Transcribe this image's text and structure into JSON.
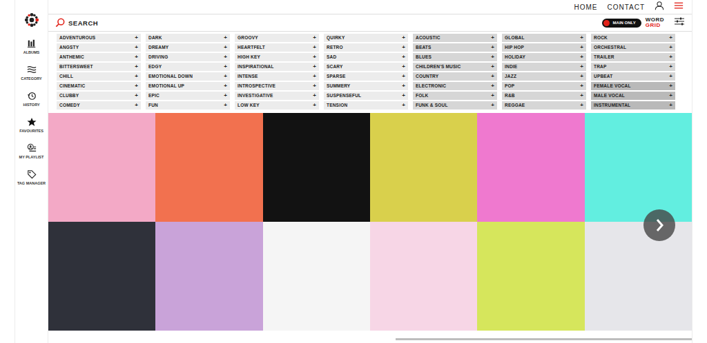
{
  "nav": {
    "links": [
      {
        "label": "HOME"
      },
      {
        "label": "CONTACT"
      }
    ]
  },
  "search": {
    "label": "SEARCH"
  },
  "toggle": {
    "label": "MAIN ONLY",
    "on": true
  },
  "brand": {
    "line1": "WORD",
    "line2": "GRID"
  },
  "sidebar": {
    "items": [
      {
        "label": "ALBUMS",
        "selected": false
      },
      {
        "label": "CATEGORY",
        "selected": false
      },
      {
        "label": "HISTORY",
        "selected": false
      },
      {
        "label": "FAVOURITES",
        "selected": false
      },
      {
        "label": "MY PLAYLIST",
        "selected": false
      },
      {
        "label": "TAG MANAGER",
        "selected": false
      }
    ]
  },
  "add_glyph": "+",
  "tag_columns": [
    {
      "tags": [
        {
          "label": "ADVENTUROUS",
          "kind": "mood",
          "selected": false
        },
        {
          "label": "ANGSTY",
          "kind": "mood",
          "selected": false
        },
        {
          "label": "ANTHEMIC",
          "kind": "mood",
          "selected": false
        },
        {
          "label": "BITTERSWEET",
          "kind": "mood",
          "selected": false
        },
        {
          "label": "CHILL",
          "kind": "mood",
          "selected": false
        },
        {
          "label": "CINEMATIC",
          "kind": "mood",
          "selected": false
        },
        {
          "label": "CLUBBY",
          "kind": "mood",
          "selected": false
        },
        {
          "label": "COMEDY",
          "kind": "mood",
          "selected": false
        }
      ]
    },
    {
      "tags": [
        {
          "label": "DARK",
          "kind": "mood",
          "selected": false
        },
        {
          "label": "DREAMY",
          "kind": "mood",
          "selected": false
        },
        {
          "label": "DRIVING",
          "kind": "mood",
          "selected": false
        },
        {
          "label": "EDGY",
          "kind": "mood",
          "selected": false
        },
        {
          "label": "EMOTIONAL DOWN",
          "kind": "mood",
          "selected": false
        },
        {
          "label": "EMOTIONAL UP",
          "kind": "mood",
          "selected": false
        },
        {
          "label": "EPIC",
          "kind": "mood",
          "selected": false
        },
        {
          "label": "FUN",
          "kind": "mood",
          "selected": false
        }
      ]
    },
    {
      "tags": [
        {
          "label": "GROOVY",
          "kind": "mood",
          "selected": false
        },
        {
          "label": "HEARTFELT",
          "kind": "mood",
          "selected": false
        },
        {
          "label": "HIGH KEY",
          "kind": "mood",
          "selected": false
        },
        {
          "label": "INSPIRATIONAL",
          "kind": "mood",
          "selected": false
        },
        {
          "label": "INTENSE",
          "kind": "mood",
          "selected": false
        },
        {
          "label": "INTROSPECTIVE",
          "kind": "mood",
          "selected": false
        },
        {
          "label": "INVESTIGATIVE",
          "kind": "mood",
          "selected": false
        },
        {
          "label": "LOW KEY",
          "kind": "mood",
          "selected": false
        }
      ]
    },
    {
      "tags": [
        {
          "label": "QUIRKY",
          "kind": "mood",
          "selected": false
        },
        {
          "label": "RETRO",
          "kind": "mood",
          "selected": false
        },
        {
          "label": "SAD",
          "kind": "mood",
          "selected": false
        },
        {
          "label": "SCARY",
          "kind": "mood",
          "selected": false
        },
        {
          "label": "SPARSE",
          "kind": "mood",
          "selected": false
        },
        {
          "label": "SUMMERY",
          "kind": "mood",
          "selected": false
        },
        {
          "label": "SUSPENSEFUL",
          "kind": "mood",
          "selected": false
        },
        {
          "label": "TENSION",
          "kind": "mood",
          "selected": false
        }
      ]
    },
    {
      "tags": [
        {
          "label": "ACOUSTIC",
          "kind": "genre",
          "selected": false
        },
        {
          "label": "BEATS",
          "kind": "genre",
          "selected": false
        },
        {
          "label": "BLUES",
          "kind": "genre",
          "selected": false
        },
        {
          "label": "CHILDREN'S MUSIC",
          "kind": "genre",
          "selected": false
        },
        {
          "label": "COUNTRY",
          "kind": "genre",
          "selected": false
        },
        {
          "label": "ELECTRONIC",
          "kind": "genre",
          "selected": false
        },
        {
          "label": "FOLK",
          "kind": "genre",
          "selected": false
        },
        {
          "label": "FUNK & SOUL",
          "kind": "genre",
          "selected": false
        }
      ]
    },
    {
      "tags": [
        {
          "label": "GLOBAL",
          "kind": "genre",
          "selected": false
        },
        {
          "label": "HIP HOP",
          "kind": "genre",
          "selected": false
        },
        {
          "label": "HOLIDAY",
          "kind": "genre",
          "selected": false
        },
        {
          "label": "INDIE",
          "kind": "genre",
          "selected": false
        },
        {
          "label": "JAZZ",
          "kind": "genre",
          "selected": false
        },
        {
          "label": "POP",
          "kind": "genre",
          "selected": false
        },
        {
          "label": "R&B",
          "kind": "genre",
          "selected": false
        },
        {
          "label": "REGGAE",
          "kind": "genre",
          "selected": false
        }
      ]
    },
    {
      "tags": [
        {
          "label": "ROCK",
          "kind": "genre",
          "selected": false
        },
        {
          "label": "ORCHESTRAL",
          "kind": "genre",
          "selected": false
        },
        {
          "label": "TRAILER",
          "kind": "genre",
          "selected": false
        },
        {
          "label": "TRAP",
          "kind": "genre",
          "selected": false
        },
        {
          "label": "UPBEAT",
          "kind": "genre",
          "selected": false
        },
        {
          "label": "FEMALE VOCAL",
          "kind": "vocal",
          "selected": false
        },
        {
          "label": "MALE VOCAL",
          "kind": "vocal",
          "selected": false
        },
        {
          "label": "INSTRUMENTAL",
          "kind": "vocal",
          "selected": false
        }
      ]
    }
  ],
  "albums": [
    {
      "color": "#f3a9c6"
    },
    {
      "color": "#f2714f"
    },
    {
      "color": "#121212"
    },
    {
      "color": "#d9d04c"
    },
    {
      "color": "#ef79cf"
    },
    {
      "color": "#62eee0"
    },
    {
      "color": "#2f313a"
    },
    {
      "color": "#c9a3d9"
    },
    {
      "color": "#f5f5f5"
    },
    {
      "color": "#f7d6e6"
    },
    {
      "color": "#d6e65c"
    },
    {
      "color": "#e6e6ea"
    }
  ],
  "scrollbar": {
    "level": 0.46
  }
}
